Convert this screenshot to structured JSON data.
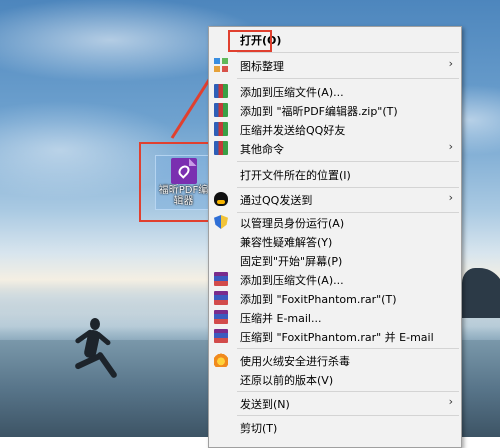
{
  "desktop": {
    "icon_label": "福昕PDF编辑器"
  },
  "context_menu": {
    "items": [
      {
        "label": "打开(O)",
        "icon": "none",
        "submenu": false,
        "bold": true
      },
      {
        "label": "图标整理",
        "icon": "grid-icon",
        "submenu": true
      },
      {
        "label": "添加到压缩文件(A)...",
        "icon": "winrar-books-icon",
        "submenu": false
      },
      {
        "label": "添加到 \"福昕PDF编辑器.zip\"(T)",
        "icon": "winrar-books-icon",
        "submenu": false
      },
      {
        "label": "压缩并发送给QQ好友",
        "icon": "winrar-books-icon",
        "submenu": false
      },
      {
        "label": "其他命令",
        "icon": "winrar-books-icon",
        "submenu": true
      },
      {
        "label": "打开文件所在的位置(I)",
        "icon": "none",
        "submenu": false
      },
      {
        "label": "通过QQ发送到",
        "icon": "qq-penguin-icon",
        "submenu": true
      },
      {
        "label": "以管理员身份运行(A)",
        "icon": "uac-shield-icon",
        "submenu": false
      },
      {
        "label": "兼容性疑难解答(Y)",
        "icon": "none",
        "submenu": false
      },
      {
        "label": "固定到\"开始\"屏幕(P)",
        "icon": "none",
        "submenu": false
      },
      {
        "label": "添加到压缩文件(A)...",
        "icon": "winrar-icon",
        "submenu": false
      },
      {
        "label": "添加到 \"FoxitPhantom.rar\"(T)",
        "icon": "winrar-icon",
        "submenu": false
      },
      {
        "label": "压缩并 E-mail...",
        "icon": "winrar-icon",
        "submenu": false
      },
      {
        "label": "压缩到 \"FoxitPhantom.rar\" 并 E-mail",
        "icon": "winrar-icon",
        "submenu": false
      },
      {
        "label": "使用火绒安全进行杀毒",
        "icon": "huorong-fire-icon",
        "submenu": false
      },
      {
        "label": "还原以前的版本(V)",
        "icon": "none",
        "submenu": false
      },
      {
        "label": "发送到(N)",
        "icon": "none",
        "submenu": true
      },
      {
        "label": "剪切(T)",
        "icon": "none",
        "submenu": false
      }
    ],
    "submenu_arrow": "›"
  },
  "annotation": {
    "color": "#e0402f"
  }
}
